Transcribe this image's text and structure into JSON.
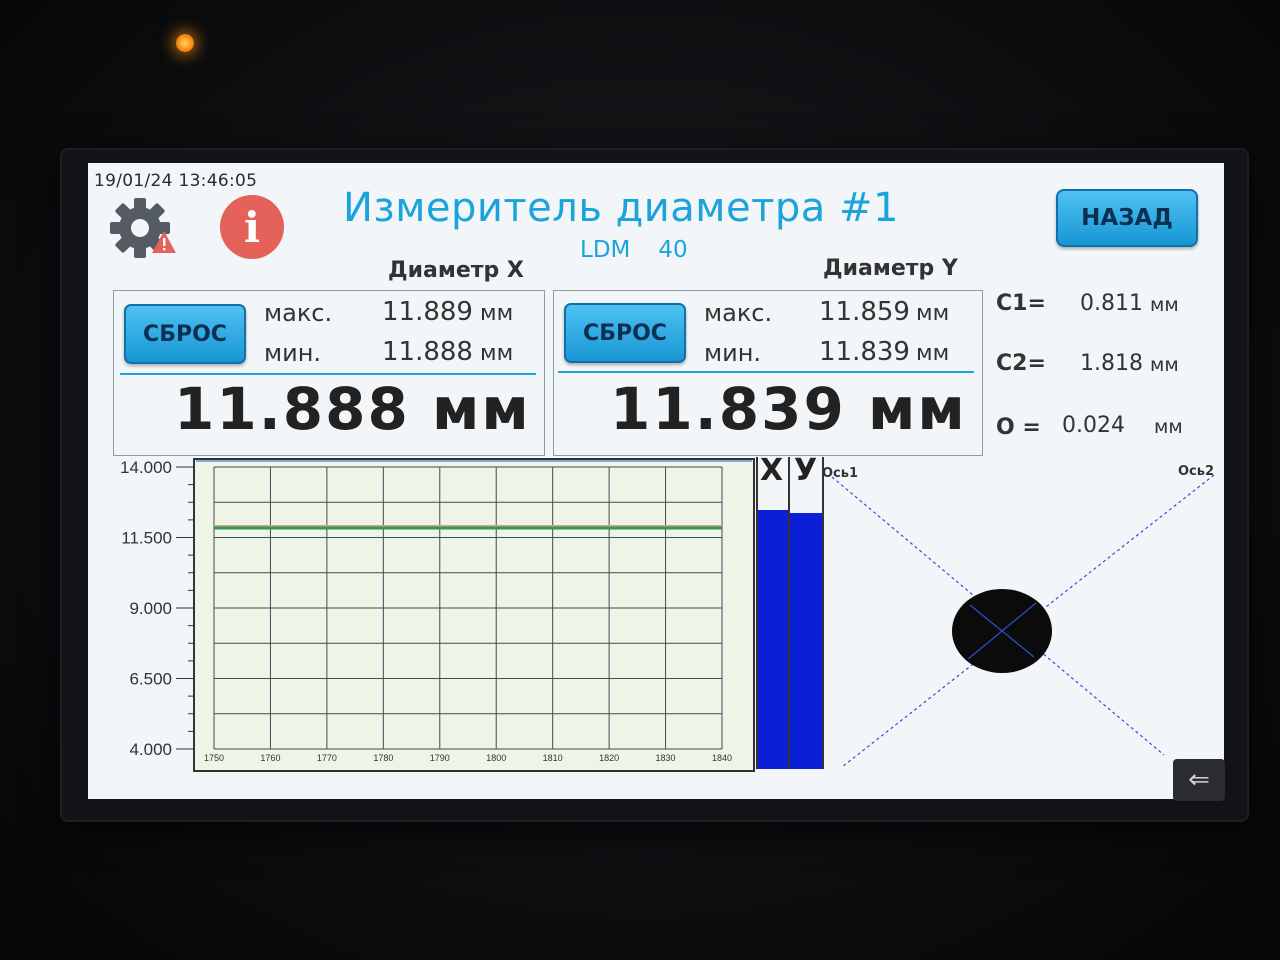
{
  "header": {
    "datetime": "19/01/24 13:46:05",
    "title": "Измеритель диаметра #1",
    "model": "LDM",
    "model_number": "40",
    "back_label": "НАЗАД"
  },
  "panel_x": {
    "title": "Диаметр X",
    "reset_label": "СБРОС",
    "max_label": "макс.",
    "max_value": "11.889",
    "min_label": "мин.",
    "min_value": "11.888",
    "unit": "мм",
    "current": "11.888 мм"
  },
  "panel_y": {
    "title": "Диаметр Y",
    "reset_label": "СБРОС",
    "max_label": "макс.",
    "max_value": "11.859",
    "min_label": "мин.",
    "min_value": "11.839",
    "unit": "мм",
    "current": "11.839 мм"
  },
  "side": {
    "c1_label": "C1=",
    "c1_value": "0.811",
    "c2_label": "C2=",
    "c2_value": "1.818",
    "o_label": "O =",
    "o_value": "0.024",
    "unit": "мм"
  },
  "bars": {
    "x_label": "X",
    "y_label": "У",
    "x_fill": 0.83,
    "y_fill": 0.82,
    "color": "#0a1fd6"
  },
  "axes_view": {
    "axis1_label": "Ось1",
    "axis2_label": "Ось2"
  },
  "chart_data": {
    "type": "line",
    "yticks": [
      "14.000",
      "11.500",
      "9.000",
      "6.500",
      "4.000"
    ],
    "ylim": [
      4.0,
      14.0
    ],
    "xticks": [
      1750,
      1760,
      1770,
      1780,
      1790,
      1800,
      1810,
      1820,
      1830,
      1840
    ],
    "xlim": [
      1750,
      1840
    ],
    "grid": true,
    "series": [
      {
        "color": "#d9a18a",
        "x": [
          1750,
          1840
        ],
        "y": [
          11.888,
          11.888
        ]
      },
      {
        "color": "#2e9a52",
        "x": [
          1750,
          1840
        ],
        "y": [
          11.839,
          11.839
        ]
      }
    ]
  },
  "icons": {
    "settings": "gear-warning-icon",
    "info": "info-icon",
    "corner": "back-arrow-icon"
  },
  "colors": {
    "accent": "#1ba3dc",
    "button": "#2aa8e6",
    "info": "#e5625a"
  }
}
